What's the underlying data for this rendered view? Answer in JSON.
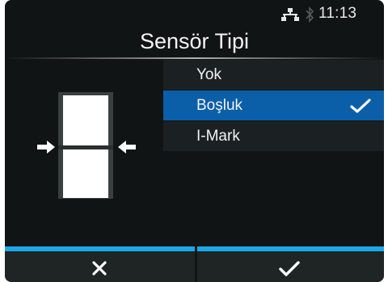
{
  "status": {
    "time": "11:13",
    "icons": [
      "network-icon",
      "bluetooth-icon"
    ]
  },
  "header": {
    "title": "Sensör Tipi"
  },
  "options": [
    {
      "label": "Yok",
      "selected": false
    },
    {
      "label": "Boşluk",
      "selected": true
    },
    {
      "label": "I-Mark",
      "selected": false
    }
  ],
  "footer": {
    "cancel_icon": "close-icon",
    "confirm_icon": "check-icon"
  },
  "colors": {
    "background": "#111414",
    "selected": "#0a5fa8",
    "accent": "#18a9e8",
    "text": "#f2f2f2"
  }
}
